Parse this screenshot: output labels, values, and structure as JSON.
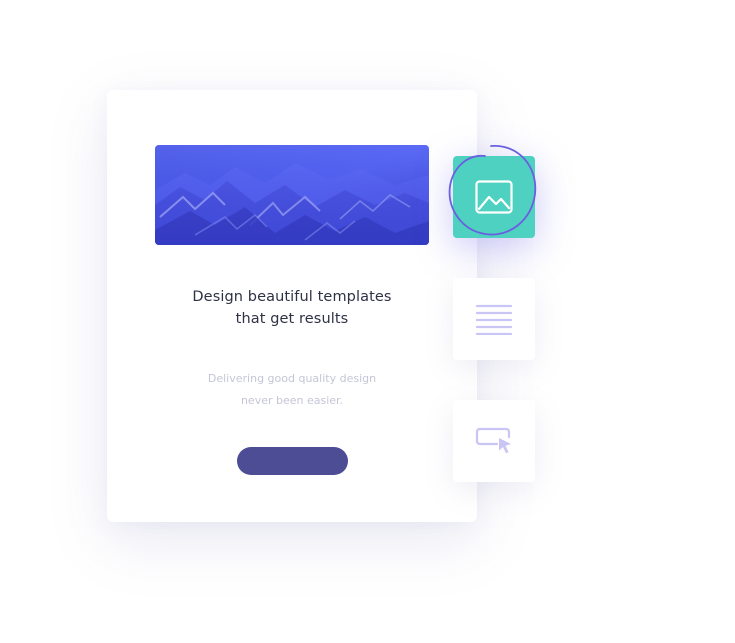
{
  "card": {
    "headline_line1": "Design beautiful templates",
    "headline_line2": "that get results",
    "sub_line1": "Delivering good quality design",
    "sub_line2": "never been easier.",
    "cta_label": ""
  },
  "tools": [
    {
      "icon": "image-icon",
      "active": true
    },
    {
      "icon": "text-lines-icon",
      "active": false
    },
    {
      "icon": "button-cursor-icon",
      "active": false
    }
  ],
  "colors": {
    "accent_teal": "#4fd1c1",
    "accent_indigo": "#4c4d94",
    "ring": "#6a5fe0",
    "hero_blue": "#4a55e8",
    "icon_lavender": "#c9c6f5"
  }
}
